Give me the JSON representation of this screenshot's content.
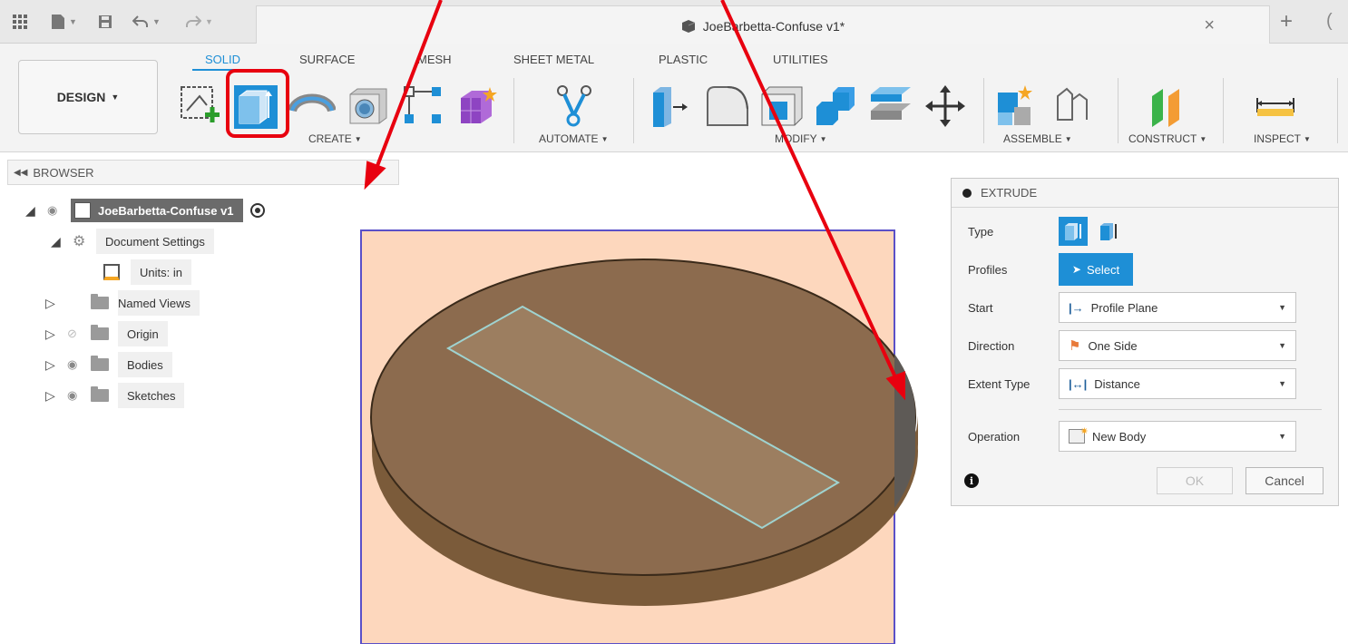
{
  "titlebar": {
    "document_title": "JoeBarbetta-Confuse v1*",
    "close_symbol": "×",
    "new_tab_symbol": "+",
    "extra_tab_glyph": "("
  },
  "ribbon": {
    "workspace_label": "DESIGN",
    "tabs": [
      "SOLID",
      "SURFACE",
      "MESH",
      "SHEET METAL",
      "PLASTIC",
      "UTILITIES"
    ],
    "active_tab": "SOLID",
    "groups": [
      "CREATE",
      "AUTOMATE",
      "MODIFY",
      "ASSEMBLE",
      "CONSTRUCT",
      "INSPECT"
    ],
    "tools": {
      "create": [
        "create-sketch-icon",
        "extrude-icon",
        "revolve-icon",
        "hole-icon",
        "pattern-icon",
        "create-form-icon"
      ],
      "automate": [
        "automate-icon"
      ],
      "modify": [
        "press-pull-icon",
        "fillet-icon",
        "shell-icon",
        "combine-icon",
        "offset-face-icon",
        "move-icon"
      ],
      "assemble": [
        "new-component-icon",
        "joint-icon"
      ],
      "construct": [
        "offset-plane-icon"
      ],
      "inspect": [
        "measure-icon"
      ]
    }
  },
  "browser": {
    "header": "BROWSER",
    "root": "JoeBarbetta-Confuse v1",
    "items": [
      {
        "label": "Document Settings"
      },
      {
        "label": "Units: in"
      },
      {
        "label": "Named Views"
      },
      {
        "label": "Origin"
      },
      {
        "label": "Bodies"
      },
      {
        "label": "Sketches"
      }
    ]
  },
  "extrude_panel": {
    "title": "EXTRUDE",
    "rows": {
      "type": {
        "label": "Type"
      },
      "profiles": {
        "label": "Profiles",
        "value": "Select"
      },
      "start": {
        "label": "Start",
        "value": "Profile Plane"
      },
      "direction": {
        "label": "Direction",
        "value": "One Side"
      },
      "extent_type": {
        "label": "Extent Type",
        "value": "Distance"
      },
      "operation": {
        "label": "Operation",
        "value": "New Body"
      }
    },
    "ok": "OK",
    "cancel": "Cancel"
  },
  "colors": {
    "accent": "#1e8fd6",
    "annotation": "#e8000f",
    "sketch_plane": "#fdd7bd",
    "disk_top": "#8c6b4e",
    "disk_side": "#7a5a38"
  }
}
